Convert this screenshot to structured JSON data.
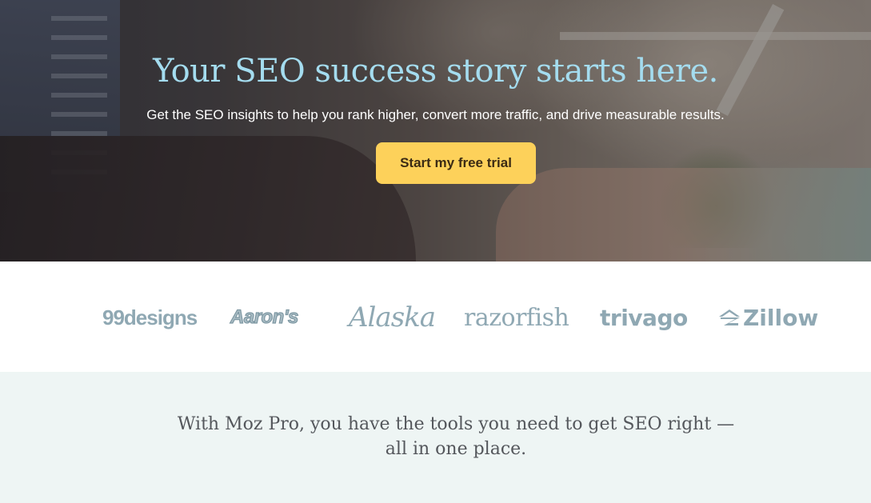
{
  "hero": {
    "title": "Your SEO success story starts here.",
    "subtitle": "Get the SEO insights to help you rank higher, convert more traffic, and drive measurable results.",
    "cta_label": "Start my free trial",
    "title_color": "#a4dcef",
    "cta_color": "#fdd15a"
  },
  "logos": [
    {
      "name": "99designs"
    },
    {
      "name": "Aaron's"
    },
    {
      "name": "Alaska"
    },
    {
      "name": "razorfish"
    },
    {
      "name": "trivago"
    },
    {
      "name": "Zillow",
      "icon": "zillow-house-icon"
    }
  ],
  "logo_color": "#8fa8b3",
  "tagline": {
    "text": "With Moz Pro, you have the tools you need to get SEO right — all in one place.",
    "band_color": "#eef5f4"
  }
}
